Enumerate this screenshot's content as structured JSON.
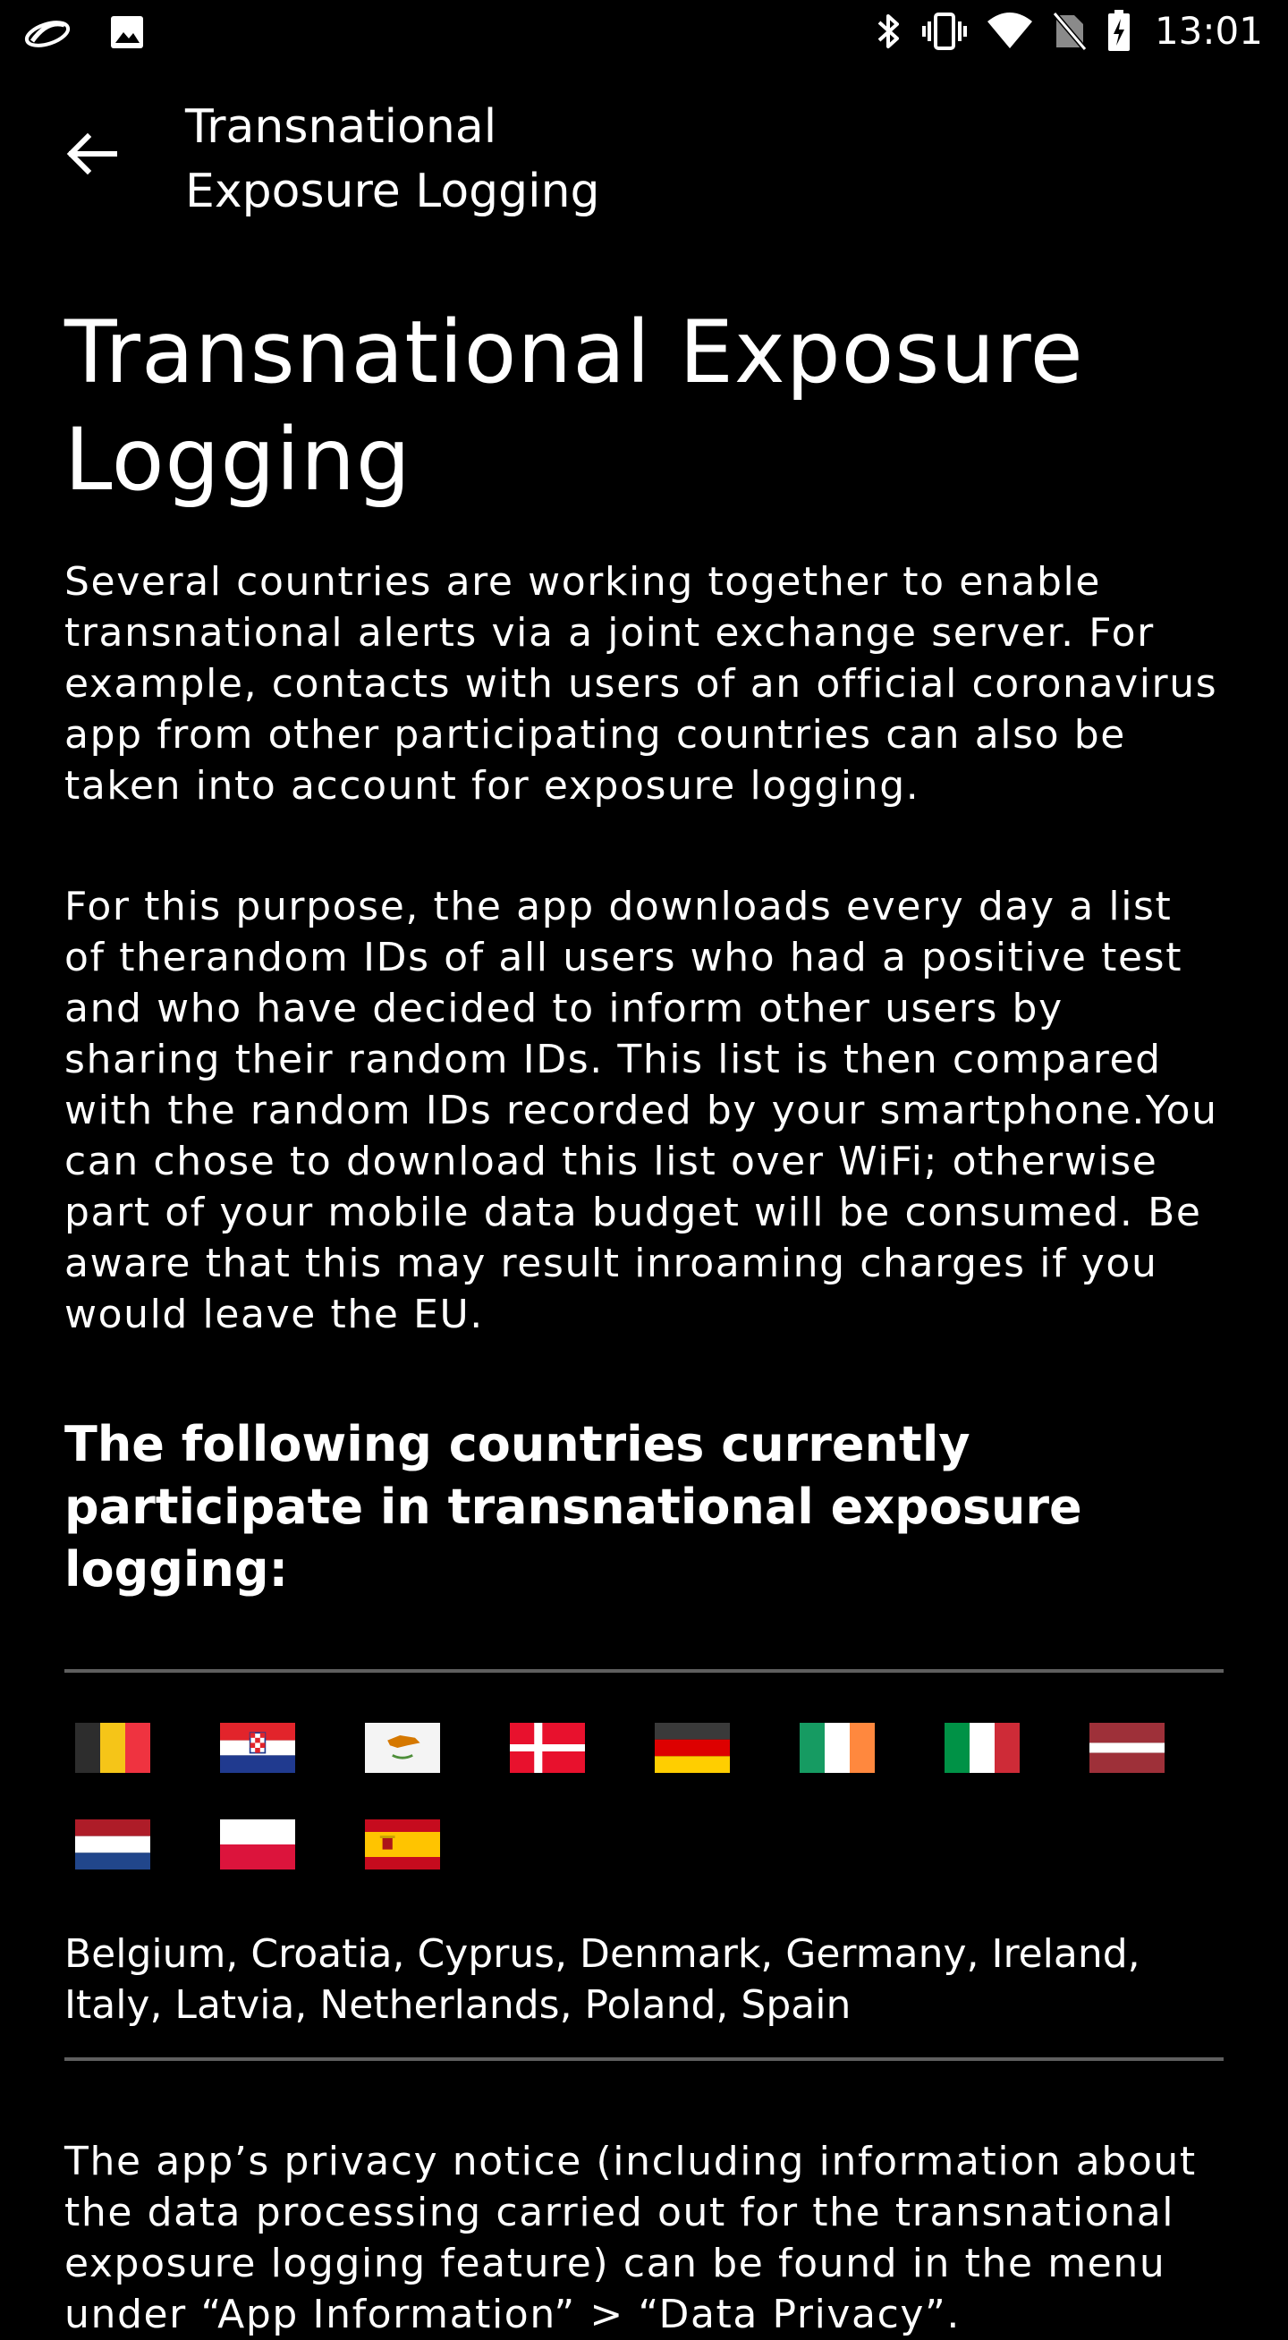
{
  "status_bar": {
    "time": "13:01",
    "left_icons": [
      "app-notification-icon",
      "image-icon"
    ],
    "right_icons": [
      "bluetooth-icon",
      "vibrate-icon",
      "wifi-icon",
      "no-sim-icon",
      "battery-charging-icon"
    ]
  },
  "app_bar": {
    "back_icon": "arrow-back-icon",
    "title_line_1": "Transnational",
    "title_line_2": "Exposure Logging"
  },
  "main": {
    "title": "Transnational Exposure Logging",
    "paragraph_1": "Several countries are working together to enable transnational alerts via a joint exchange server. For example, contacts with users of an official coronavirus app from other participating countries can also be taken into account for exposure logging.",
    "paragraph_2": "For this purpose, the app downloads every day a list of therandom IDs of all users who had a positive test and who have decided to inform other users by sharing their random IDs. This list is then compared with the random IDs recorded by your smartphone.You can chose to download this list over WiFi; otherwise part of your mobile data budget will be consumed. Be aware that this may result inroaming charges if you would leave the EU.",
    "countries_heading": "The following countries currently participate in transnational exposure logging:",
    "flags": [
      {
        "country": "Belgium",
        "icon": "belgium-flag-icon"
      },
      {
        "country": "Croatia",
        "icon": "croatia-flag-icon"
      },
      {
        "country": "Cyprus",
        "icon": "cyprus-flag-icon"
      },
      {
        "country": "Denmark",
        "icon": "denmark-flag-icon"
      },
      {
        "country": "Germany",
        "icon": "germany-flag-icon"
      },
      {
        "country": "Ireland",
        "icon": "ireland-flag-icon"
      },
      {
        "country": "Italy",
        "icon": "italy-flag-icon"
      },
      {
        "country": "Latvia",
        "icon": "latvia-flag-icon"
      },
      {
        "country": "Netherlands",
        "icon": "netherlands-flag-icon"
      },
      {
        "country": "Poland",
        "icon": "poland-flag-icon"
      },
      {
        "country": "Spain",
        "icon": "spain-flag-icon"
      }
    ],
    "countries_list": "Belgium, Croatia, Cyprus, Denmark, Germany, Ireland, Italy, Latvia, Netherlands, Poland, Spain",
    "privacy_notice": "The app’s privacy notice (including information about the data processing carried out for the transnational exposure logging feature) can be found in the menu under “App Information” > “Data Privacy”."
  },
  "colors": {
    "background": "#000000",
    "text": "#ffffff",
    "divider": "#5f5f5f"
  }
}
